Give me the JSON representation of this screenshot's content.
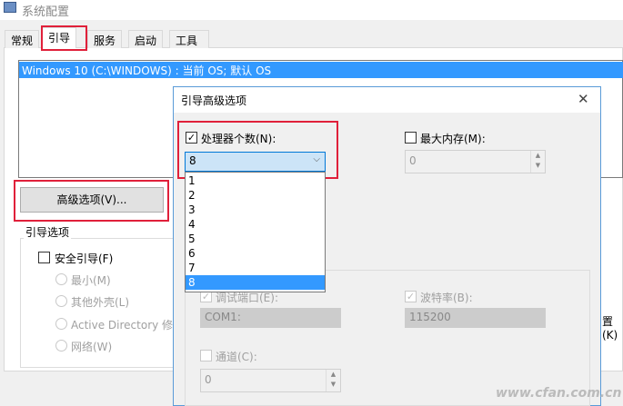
{
  "window": {
    "title": "系统配置"
  },
  "tabs": [
    {
      "label": "常规"
    },
    {
      "label": "引导"
    },
    {
      "label": "服务"
    },
    {
      "label": "启动"
    },
    {
      "label": "工具"
    }
  ],
  "boot_list": {
    "selected": "Windows 10 (C:\\WINDOWS) : 当前 OS; 默认 OS"
  },
  "advanced_button": "高级选项(V)...",
  "boot_options": {
    "title": "引导选项",
    "safe_boot": "安全引导(F)",
    "radios": [
      "最小(M)",
      "其他外壳(L)",
      "Active Directory 修",
      "网络(W)"
    ],
    "right_fragment": "置(K)"
  },
  "dialog": {
    "title": "引导高级选项",
    "close": "✕",
    "num_processors": {
      "label": "处理器个数(N):",
      "checked": true,
      "value": "8",
      "options": [
        "1",
        "2",
        "3",
        "4",
        "5",
        "6",
        "7",
        "8"
      ],
      "highlighted": "8"
    },
    "max_memory": {
      "label": "最大内存(M):",
      "checked": false,
      "value": "0"
    },
    "debug_port": {
      "label": "调试端口(E):",
      "checked": true,
      "value": "COM1:"
    },
    "baud_rate": {
      "label": "波特率(B):",
      "checked": true,
      "value": "115200"
    },
    "channel": {
      "label": "通道(C):",
      "checked": false,
      "value": "0"
    }
  },
  "watermark": "www.cfan.com.cn",
  "colors": {
    "selection": "#3399ff",
    "highlight_box": "#e0203a"
  }
}
